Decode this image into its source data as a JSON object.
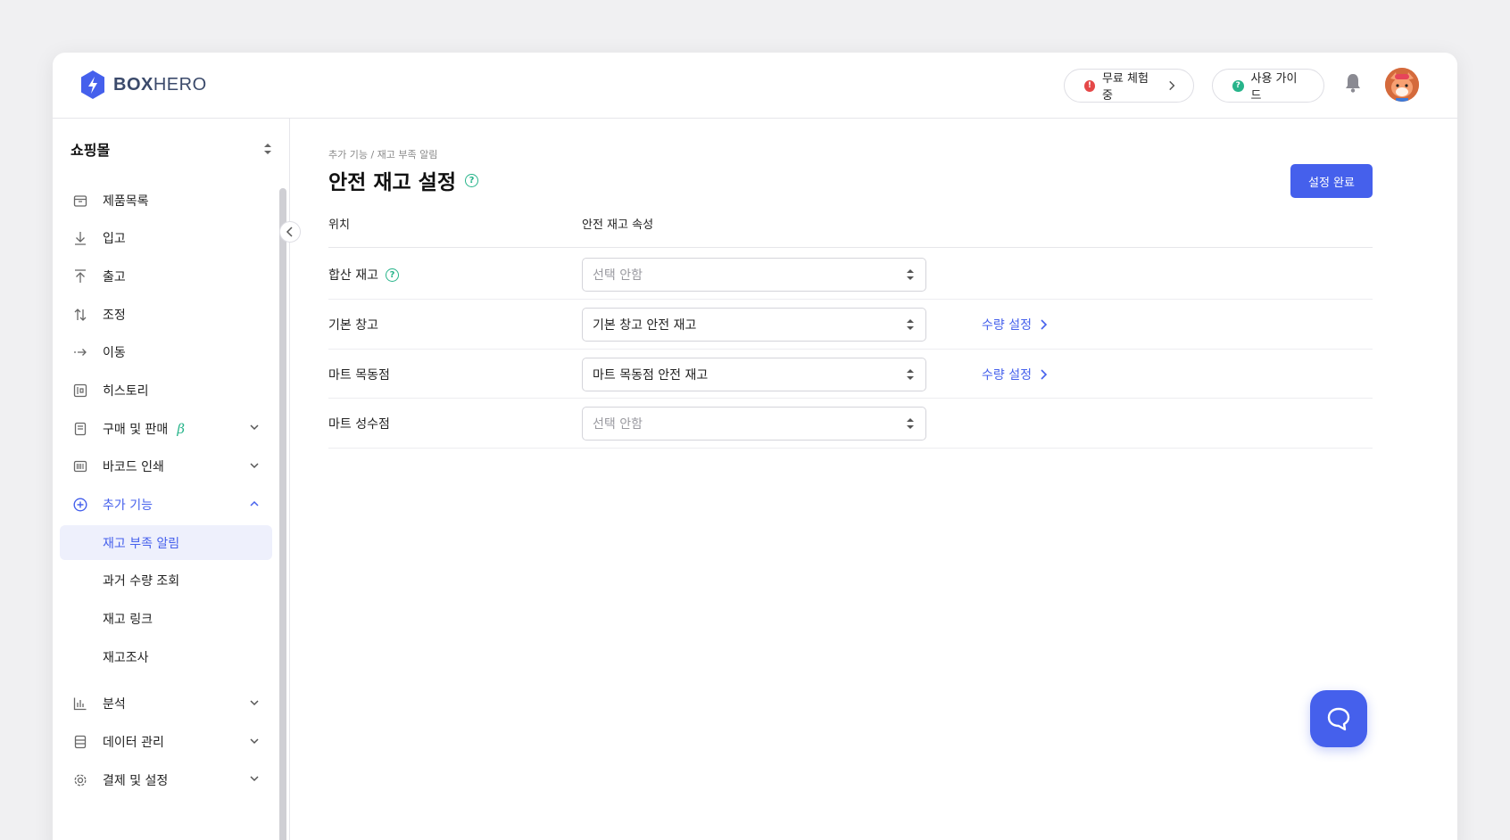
{
  "header": {
    "logo_prefix": "BOX",
    "logo_suffix": "HERO",
    "trial_label": "무료 체험중",
    "guide_label": "사용 가이드"
  },
  "sidebar": {
    "store_name": "쇼핑몰",
    "items": [
      {
        "label": "제품목록",
        "icon": "box-icon"
      },
      {
        "label": "입고",
        "icon": "arrow-down-icon"
      },
      {
        "label": "출고",
        "icon": "arrow-up-icon"
      },
      {
        "label": "조정",
        "icon": "arrow-updown-icon"
      },
      {
        "label": "이동",
        "icon": "arrow-right-icon"
      },
      {
        "label": "히스토리",
        "icon": "history-icon"
      },
      {
        "label": "구매 및 판매",
        "icon": "document-icon",
        "badge": "β"
      },
      {
        "label": "바코드 인쇄",
        "icon": "barcode-icon"
      },
      {
        "label": "추가 기능",
        "icon": "plus-circle-icon"
      }
    ],
    "sub_items": [
      {
        "label": "재고 부족 알림"
      },
      {
        "label": "과거 수량 조회"
      },
      {
        "label": "재고 링크"
      },
      {
        "label": "재고조사"
      }
    ],
    "bottom_items": [
      {
        "label": "분석",
        "icon": "chart-icon"
      },
      {
        "label": "데이터 관리",
        "icon": "database-icon"
      },
      {
        "label": "결제 및 설정",
        "icon": "gear-icon"
      }
    ]
  },
  "main": {
    "breadcrumb": "추가 기능 / 재고 부족 알림",
    "title": "안전 재고 설정",
    "done_button": "설정 완료",
    "col_location": "위치",
    "col_attribute": "안전 재고 속성",
    "rows": [
      {
        "location": "합산 재고",
        "value": "선택 안함",
        "link": ""
      },
      {
        "location": "기본 창고",
        "value": "기본 창고 안전 재고",
        "link": "수량 설정"
      },
      {
        "location": "마트 목동점",
        "value": "마트 목동점 안전 재고",
        "link": "수량 설정"
      },
      {
        "location": "마트 성수점",
        "value": "선택 안함",
        "link": ""
      }
    ]
  },
  "colors": {
    "accent": "#4560ec",
    "help": "#27b48a",
    "alert": "#e54848"
  }
}
